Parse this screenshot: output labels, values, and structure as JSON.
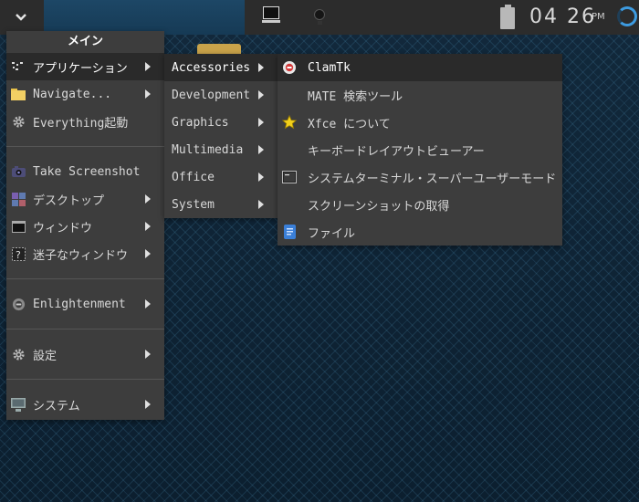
{
  "shelf": {
    "clock_time": "04 26",
    "clock_ampm": "PM"
  },
  "main_menu": {
    "title": "メイン",
    "items": [
      {
        "label": "アプリケーション",
        "icon": "apps-icon",
        "submenu": true
      },
      {
        "label": "Navigate...",
        "icon": "folder-icon",
        "submenu": true
      },
      {
        "label": "Everything起動",
        "icon": "gear-icon",
        "submenu": false
      },
      {
        "label": "Take Screenshot",
        "icon": "camera-icon",
        "submenu": false
      },
      {
        "label": "デスクトップ",
        "icon": "desktop-icon",
        "submenu": true
      },
      {
        "label": "ウィンドウ",
        "icon": "window-icon",
        "submenu": true
      },
      {
        "label": "迷子なウィンドウ",
        "icon": "lost-window-icon",
        "submenu": true
      },
      {
        "label": "Enlightenment",
        "icon": "enlightenment-icon",
        "submenu": true
      },
      {
        "label": "設定",
        "icon": "settings-gear-icon",
        "submenu": true
      },
      {
        "label": "システム",
        "icon": "computer-icon",
        "submenu": true
      }
    ]
  },
  "apps_menu": {
    "items": [
      {
        "label": "Accessories",
        "submenu": true
      },
      {
        "label": "Development",
        "submenu": true
      },
      {
        "label": "Graphics",
        "submenu": true
      },
      {
        "label": "Multimedia",
        "submenu": true
      },
      {
        "label": "Office",
        "submenu": true
      },
      {
        "label": "System",
        "submenu": true
      }
    ]
  },
  "accessories_menu": {
    "items": [
      {
        "label": "ClamTk",
        "icon": "clamtk-icon"
      },
      {
        "label": "MATE 検索ツール",
        "icon": ""
      },
      {
        "label": "Xfce について",
        "icon": "star-icon"
      },
      {
        "label": "キーボードレイアウトビューアー",
        "icon": ""
      },
      {
        "label": "システムターミナル・スーパーユーザーモード",
        "icon": "terminal-icon"
      },
      {
        "label": "スクリーンショットの取得",
        "icon": ""
      },
      {
        "label": "ファイル",
        "icon": "file-icon"
      }
    ]
  },
  "colors": {
    "accent": "#3d9be0",
    "menu_bg": "#3d3d3d",
    "highlight_bg": "#2a2a2a",
    "shelf_bg": "#2c2c2c"
  }
}
